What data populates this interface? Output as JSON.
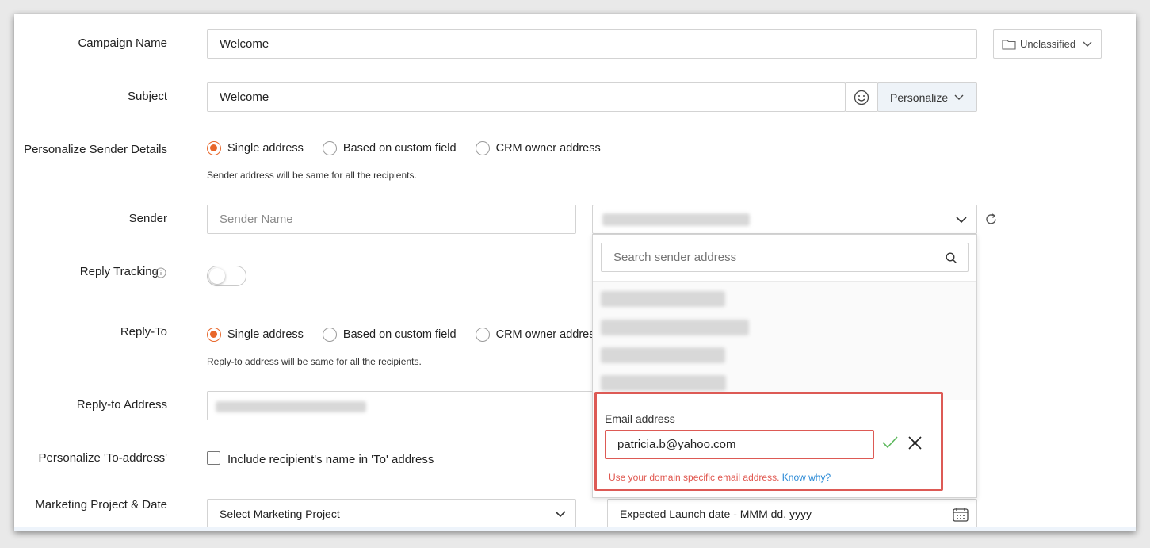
{
  "form": {
    "campaign_name": {
      "label": "Campaign Name",
      "value": "Welcome"
    },
    "folder": {
      "label": "Unclassified"
    },
    "subject": {
      "label": "Subject",
      "value": "Welcome",
      "personalize_label": "Personalize"
    },
    "personalize_sender": {
      "label": "Personalize Sender Details",
      "options": [
        "Single address",
        "Based on custom field",
        "CRM owner address"
      ],
      "selected": "Single address",
      "hint": "Sender address will be same for all the recipients."
    },
    "sender": {
      "label": "Sender",
      "name_placeholder": "Sender Name",
      "search_placeholder": "Search sender address"
    },
    "reply_tracking": {
      "label": "Reply Tracking",
      "enabled": false
    },
    "reply_to": {
      "label": "Reply-To",
      "options": [
        "Single address",
        "Based on custom field",
        "CRM owner address"
      ],
      "selected": "Single address",
      "hint": "Reply-to address will be same for all the recipients."
    },
    "reply_to_address": {
      "label": "Reply-to Address"
    },
    "personalize_to": {
      "label": "Personalize 'To-address'",
      "checkbox_label": "Include recipient's name in 'To' address",
      "checked": false
    },
    "marketing": {
      "label": "Marketing Project & Date",
      "project_placeholder": "Select Marketing Project",
      "date_placeholder": "Expected Launch date - MMM dd, yyyy"
    }
  },
  "email_popup": {
    "label": "Email address",
    "value": "patricia.b@yahoo.com",
    "warning": "Use your domain specific email address.",
    "link": "Know why?"
  },
  "colors": {
    "accent": "#e8672b",
    "highlight_border": "#dd5a55",
    "link": "#2d8bd6",
    "warning": "#e0574f",
    "confirm": "#5cb85c"
  }
}
